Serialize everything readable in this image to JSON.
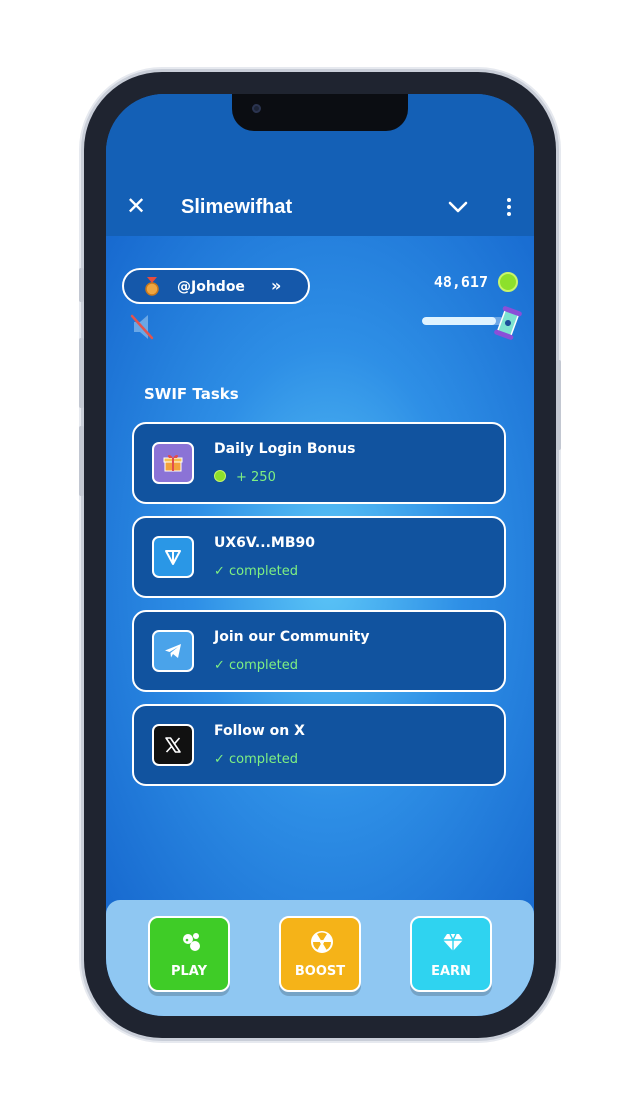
{
  "header": {
    "title": "Slimewifhat"
  },
  "user": {
    "handle": "@Johdoe",
    "arrows": "»"
  },
  "balance": {
    "coins": "48,617",
    "progress_fraction": 0.9
  },
  "tasks_section": {
    "title": "SWIF Tasks"
  },
  "tasks": [
    {
      "title": "Daily Login Bonus",
      "status": "+ 250",
      "icon": "gift-icon",
      "icon_bg": "#8b73d6"
    },
    {
      "title": "UX6V...MB90",
      "status": "✓ completed",
      "icon": "ton-icon",
      "icon_bg": "#2a97e6"
    },
    {
      "title": "Join our Community",
      "status": "✓ completed",
      "icon": "telegram-icon",
      "icon_bg": "#4aa3ea"
    },
    {
      "title": "Follow on X",
      "status": "✓ completed",
      "icon": "x-logo-icon",
      "icon_bg": "#111111"
    }
  ],
  "nav": {
    "play": {
      "label": "PLAY",
      "color": "#3fcc27"
    },
    "boost": {
      "label": "BOOST",
      "color": "#f5b318"
    },
    "earn": {
      "label": "EARN",
      "color": "#2fd3f0"
    }
  },
  "colors": {
    "accent_green": "#7ff082",
    "header_bg": "#1460b6",
    "card_bg": "#11539f"
  }
}
